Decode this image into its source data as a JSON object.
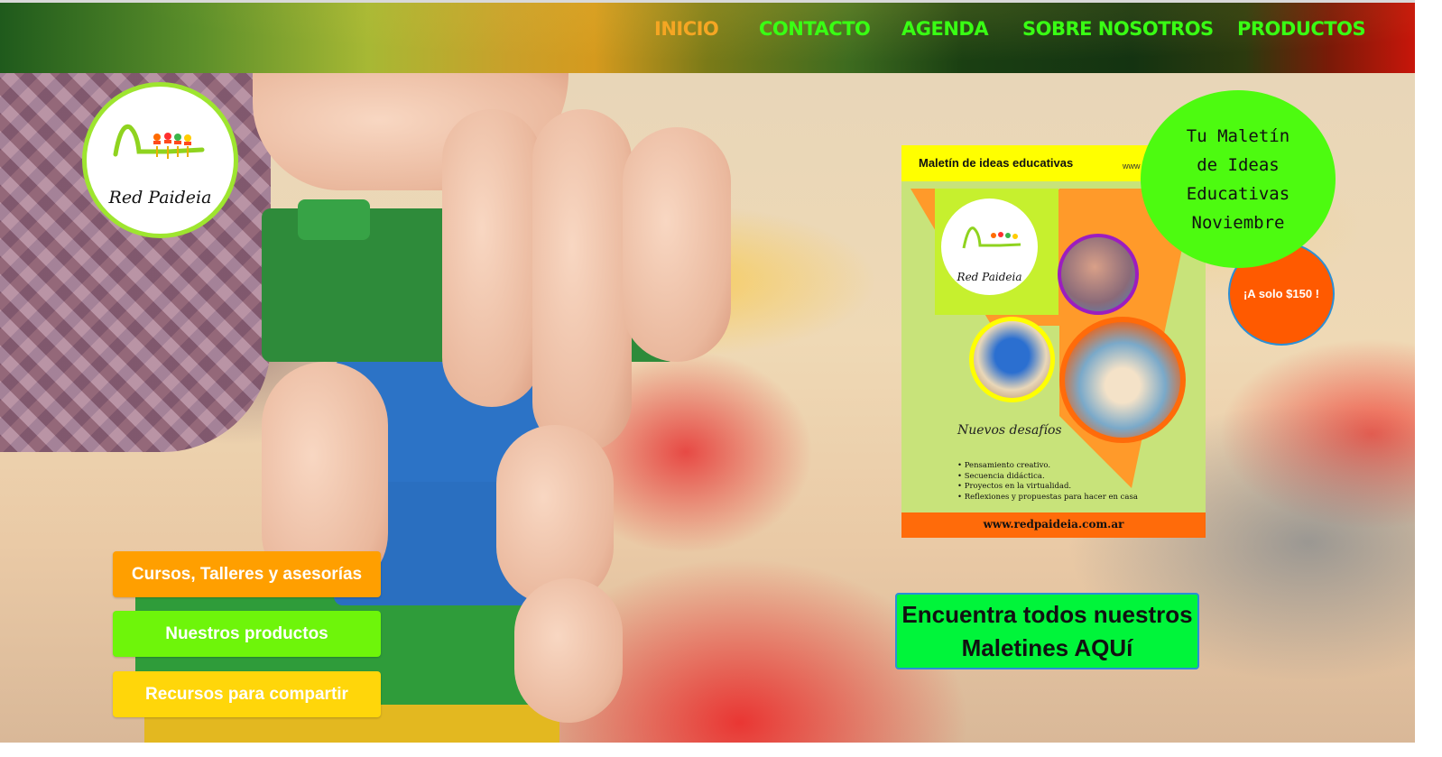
{
  "nav": {
    "items": [
      {
        "label": "INICIO",
        "color": "#f5a623"
      },
      {
        "label": "CONTACTO",
        "color": "#39ff14"
      },
      {
        "label": "AGENDA",
        "color": "#39ff14"
      },
      {
        "label": "SOBRE NOSOTROS",
        "color": "#39ff14"
      },
      {
        "label": "PRODUCTOS",
        "color": "#39ff14"
      }
    ]
  },
  "logo": {
    "text": "Red Paideia"
  },
  "buttons": [
    {
      "label": "Cursos, Talleres y asesorías",
      "color": "#ff9f00"
    },
    {
      "label": "Nuestros productos",
      "color": "#6ef50a"
    },
    {
      "label": "Recursos para compartir",
      "color": "#ffd60a"
    }
  ],
  "poster": {
    "header": "Maletín de ideas educativas",
    "header_url": "www",
    "logo_text": "Red Paideia",
    "subtitle": "Nuevos desafíos",
    "bullets": [
      "Pensamiento creativo.",
      "Secuencia didáctica.",
      "Proyectos en la virtualidad.",
      "Reflexiones y propuestas para hacer en casa"
    ],
    "footer": "www.redpaideia.com.ar"
  },
  "promo": {
    "title_lines": [
      "Tu Maletín",
      "de Ideas",
      "Educativas",
      "Noviembre"
    ],
    "price": "¡A solo $150 !"
  },
  "cta": {
    "lines": [
      "Encuentra todos nuestros",
      "Maletines AQUí"
    ]
  }
}
